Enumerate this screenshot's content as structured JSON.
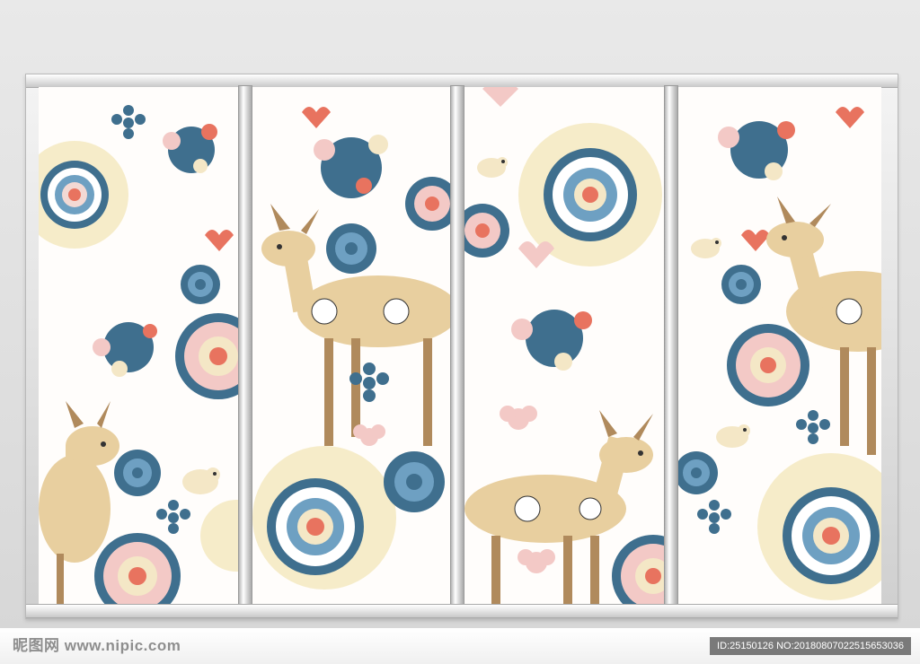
{
  "watermark": {
    "text": "昵图网 www.nipic.com"
  },
  "image_id": {
    "text": "ID:25150126 NO:20180807022515653036"
  },
  "colors": {
    "deer": "#e8cf9f",
    "deer_dark": "#b08a5c",
    "blue": "#3f6f8e",
    "pink": "#f3c9c6",
    "coral": "#e8735f",
    "cream": "#f4e7c6",
    "background": "#fffdfb"
  },
  "icons": [
    "deer-illustration",
    "mandala-flower-icon",
    "blossom-icon",
    "heart-icon",
    "bird-icon",
    "star-flower-icon"
  ]
}
